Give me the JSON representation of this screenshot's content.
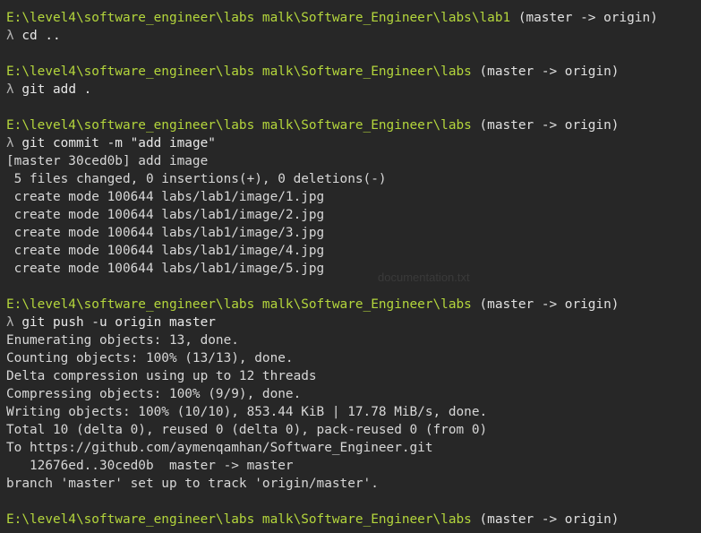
{
  "terminal": {
    "lines": [
      {
        "type": "path",
        "path": "E:\\level4\\software_engineer\\labs malk\\Software_Engineer\\labs\\lab1",
        "branch": " (master -> origin)"
      },
      {
        "type": "cmd",
        "prompt": "λ",
        "text": " cd .."
      },
      {
        "type": "blank"
      },
      {
        "type": "path",
        "path": "E:\\level4\\software_engineer\\labs malk\\Software_Engineer\\labs",
        "branch": " (master -> origin)"
      },
      {
        "type": "cmd",
        "prompt": "λ",
        "text": " git add ."
      },
      {
        "type": "blank"
      },
      {
        "type": "path",
        "path": "E:\\level4\\software_engineer\\labs malk\\Software_Engineer\\labs",
        "branch": " (master -> origin)"
      },
      {
        "type": "cmd",
        "prompt": "λ",
        "text": " git commit -m \"add image\""
      },
      {
        "type": "out",
        "text": "[master 30ced0b] add image"
      },
      {
        "type": "out",
        "text": " 5 files changed, 0 insertions(+), 0 deletions(-)"
      },
      {
        "type": "out",
        "text": " create mode 100644 labs/lab1/image/1.jpg"
      },
      {
        "type": "out",
        "text": " create mode 100644 labs/lab1/image/2.jpg"
      },
      {
        "type": "out",
        "text": " create mode 100644 labs/lab1/image/3.jpg"
      },
      {
        "type": "out",
        "text": " create mode 100644 labs/lab1/image/4.jpg"
      },
      {
        "type": "out",
        "text": " create mode 100644 labs/lab1/image/5.jpg"
      },
      {
        "type": "blank"
      },
      {
        "type": "path",
        "path": "E:\\level4\\software_engineer\\labs malk\\Software_Engineer\\labs",
        "branch": " (master -> origin)"
      },
      {
        "type": "cmd",
        "prompt": "λ",
        "text": " git push -u origin master"
      },
      {
        "type": "out",
        "text": "Enumerating objects: 13, done."
      },
      {
        "type": "out",
        "text": "Counting objects: 100% (13/13), done."
      },
      {
        "type": "out",
        "text": "Delta compression using up to 12 threads"
      },
      {
        "type": "out",
        "text": "Compressing objects: 100% (9/9), done."
      },
      {
        "type": "out",
        "text": "Writing objects: 100% (10/10), 853.44 KiB | 17.78 MiB/s, done."
      },
      {
        "type": "out",
        "text": "Total 10 (delta 0), reused 0 (delta 0), pack-reused 0 (from 0)"
      },
      {
        "type": "out",
        "text": "To https://github.com/aymenqamhan/Software_Engineer.git"
      },
      {
        "type": "out",
        "text": "   12676ed..30ced0b  master -> master"
      },
      {
        "type": "out",
        "text": "branch 'master' set up to track 'origin/master'."
      },
      {
        "type": "blank"
      },
      {
        "type": "path",
        "path": "E:\\level4\\software_engineer\\labs malk\\Software_Engineer\\labs",
        "branch": " (master -> origin)"
      }
    ]
  },
  "background": {
    "file_label": "documentation.txt"
  },
  "colors": {
    "path": "#b4d63c",
    "background": "#272727",
    "text": "#dcdcdc"
  }
}
